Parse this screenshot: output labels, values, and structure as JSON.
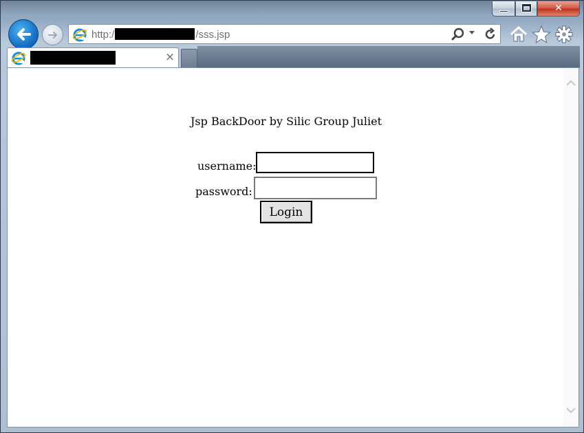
{
  "window": {
    "minimize_glyph": "",
    "maximize_glyph": "",
    "close_glyph": "✕"
  },
  "address_bar": {
    "prefix": "http:/",
    "suffix": "/sss.jsp"
  },
  "tab": {
    "close_glyph": "×"
  },
  "page": {
    "heading": "Jsp BackDoor by Silic Group Juliet",
    "username_label": "username:",
    "password_label": "password:",
    "username_value": "",
    "password_value": "",
    "login_label": "Login"
  },
  "colors": {
    "back_button": "#1673c9",
    "close_button": "#c0301a"
  }
}
